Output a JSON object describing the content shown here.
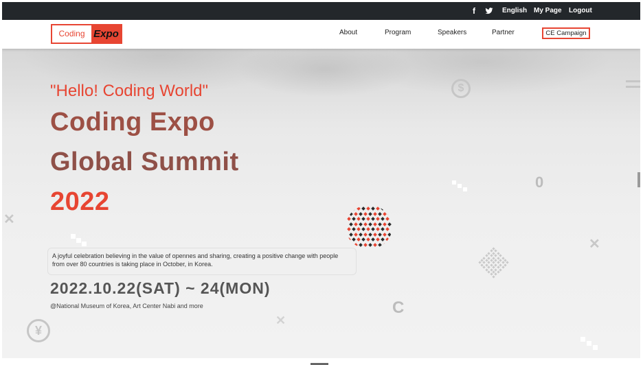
{
  "topbar": {
    "facebook_icon": "f",
    "twitter_icon": "🐦",
    "language": "English",
    "mypage": "My Page",
    "logout": "Logout"
  },
  "logo": {
    "part1": "Coding",
    "part2": "Expo"
  },
  "nav": {
    "items": [
      "About",
      "Program",
      "Speakers",
      "Partner"
    ],
    "cta": "CE Campaign"
  },
  "hero": {
    "greeting": "\"Hello! Coding World\"",
    "title_lines": [
      "Coding Expo",
      "Global Summit",
      "2022"
    ],
    "description": "A joyful celebration believing in the value of opennes and sharing, creating a positive change with people from over 80 countries is taking place in October, in Korea.",
    "dates": "2022.10.22(SAT) ~ 24(MON)",
    "venue": "@National Museum of Korea, Art Center Nabi and more",
    "deco_symbols": {
      "dollar": "$",
      "yen": "¥",
      "zero": "0",
      "cent": "C"
    }
  },
  "colors": {
    "accent": "#e74532",
    "title_dark": "#9a5048",
    "topbar": "#23272b"
  }
}
